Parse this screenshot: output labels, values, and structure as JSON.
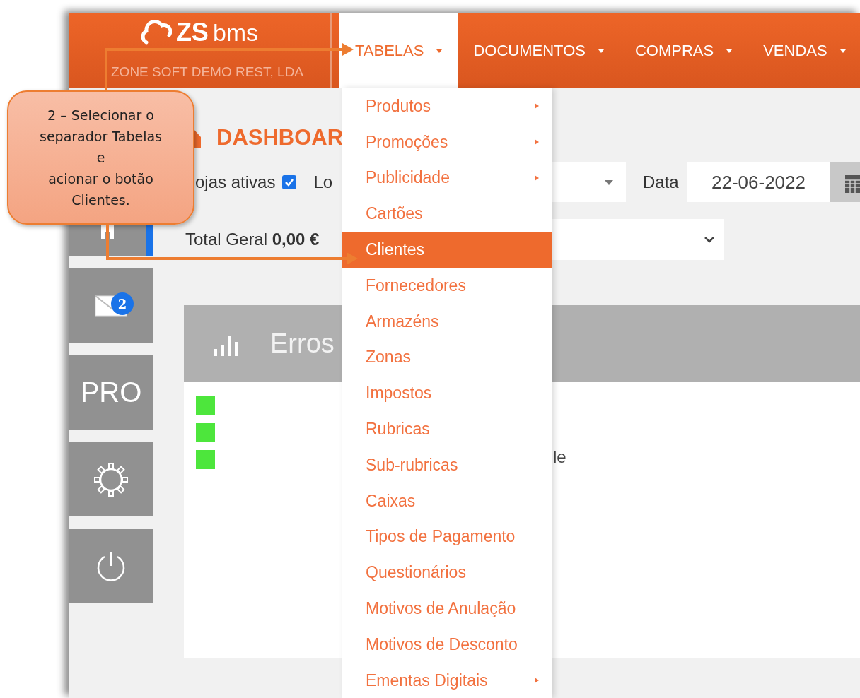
{
  "header": {
    "logo": {
      "mark": "ZS",
      "name": "bms",
      "company": "ZONE SOFT DEMO REST, LDA"
    },
    "tabs": [
      {
        "label": "TABELAS",
        "selected": true
      },
      {
        "label": "DOCUMENTOS",
        "selected": false
      },
      {
        "label": "COMPRAS",
        "selected": false
      },
      {
        "label": "VENDAS",
        "selected": false
      }
    ]
  },
  "sidebar": {
    "items": [
      {
        "kind": "store",
        "selected": true
      },
      {
        "kind": "mail",
        "badge": "2",
        "selected": false
      },
      {
        "kind": "text",
        "label": "PRO",
        "selected": false
      },
      {
        "kind": "settings",
        "selected": false
      },
      {
        "kind": "power",
        "selected": false
      }
    ]
  },
  "dashboard": {
    "title": "DASHBOAR",
    "active_stores_label": "ojas ativas",
    "active_stores_checked": true,
    "store_label": "Lo",
    "date_label": "Data",
    "date_value": "22-06-2022",
    "total_label": "Total Geral",
    "total_value": "0,00 €",
    "panel": {
      "title": "Erros",
      "legend": [
        {
          "color": "#4de63c"
        },
        {
          "color": "#4de63c"
        },
        {
          "color": "#4de63c"
        }
      ],
      "partial_text": "le"
    }
  },
  "menu": {
    "items": [
      {
        "label": "Produtos",
        "submenu": true,
        "selected": false
      },
      {
        "label": "Promoções",
        "submenu": true,
        "selected": false
      },
      {
        "label": "Publicidade",
        "submenu": true,
        "selected": false
      },
      {
        "label": "Cartões",
        "submenu": false,
        "selected": false
      },
      {
        "label": "Clientes",
        "submenu": false,
        "selected": true
      },
      {
        "label": "Fornecedores",
        "submenu": false,
        "selected": false
      },
      {
        "label": "Armazéns",
        "submenu": false,
        "selected": false
      },
      {
        "label": "Zonas",
        "submenu": false,
        "selected": false
      },
      {
        "label": "Impostos",
        "submenu": false,
        "selected": false
      },
      {
        "label": "Rubricas",
        "submenu": false,
        "selected": false
      },
      {
        "label": "Sub-rubricas",
        "submenu": false,
        "selected": false
      },
      {
        "label": "Caixas",
        "submenu": false,
        "selected": false
      },
      {
        "label": "Tipos de Pagamento",
        "submenu": false,
        "selected": false
      },
      {
        "label": "Questionários",
        "submenu": false,
        "selected": false
      },
      {
        "label": "Motivos de Anulação",
        "submenu": false,
        "selected": false
      },
      {
        "label": "Motivos de Desconto",
        "submenu": false,
        "selected": false
      },
      {
        "label": "Ementas Digitais",
        "submenu": true,
        "selected": false
      }
    ]
  },
  "callout": {
    "lines": [
      "2 – Selecionar o",
      "separador Tabelas",
      "e",
      "acionar o botão",
      "Clientes."
    ]
  }
}
